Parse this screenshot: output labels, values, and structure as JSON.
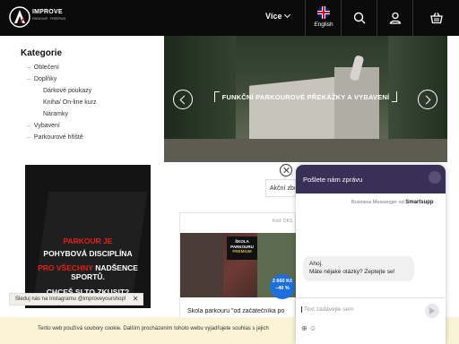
{
  "brand": {
    "line1": "IMPROVE",
    "line2": "PARKOUR · FREERUN"
  },
  "header": {
    "more_label": "Více",
    "language_label": "English"
  },
  "sidebar": {
    "title": "Kategorie",
    "items": [
      {
        "label": "Oblečení"
      },
      {
        "label": "Doplňky"
      },
      {
        "label": "Dárkové poukazy"
      },
      {
        "label": "Kniha/ On-line kurz"
      },
      {
        "label": "Náramky"
      },
      {
        "label": "Vybavení"
      },
      {
        "label": "Parkourové hřiště"
      }
    ]
  },
  "hero": {
    "caption": "FUNKČNÍ PARKOUROVÉ PŘEKÁŽKY A VYBAVENÍ"
  },
  "promo": {
    "line1": "PARKOUR JE",
    "line2": "POHYBOVÁ DISCIPLÍNA",
    "line3a": "PRO VŠECHNY",
    "line3b": " NADŠENCE SPORTŮ.",
    "line4": "CHCEŠ SI TO ZKUSIT?"
  },
  "filter": {
    "label": "Akční zboží"
  },
  "product": {
    "code": "Kód: OKS",
    "image_title_1": "ŠKOLA",
    "image_title_2": "PARKOURU",
    "image_title_3": "PREMIUM",
    "price": "2 660 Kč",
    "discount": "–40 %",
    "name": "Škola parkouru \"od začátečníka po"
  },
  "instagram": {
    "text": "Sleduj nás na Instagramu @improveyourshop!",
    "close": "✕"
  },
  "cookie": {
    "text": "Tento web používá soubory cookie. Dalším procházením tohoto webu vyjadřujete souhlas s jejich"
  },
  "chat": {
    "title": "Pošlete nám zprávu",
    "by_prefix": "Business Messenger od",
    "by_brand": "Smartsupp",
    "message_line1": "Ahoj.",
    "message_line2": "Máte nějaké otázky? Zeptejte se!",
    "input_placeholder": "Text zadávejte sem",
    "tools": "⊕ ☺"
  },
  "colors": {
    "header_bg": "#0b0b0b",
    "chat_header": "#3a2f56",
    "accent_red": "#e2231a",
    "price_badge": "#1e6fd9",
    "cookie_bg": "#fbf3d6"
  }
}
